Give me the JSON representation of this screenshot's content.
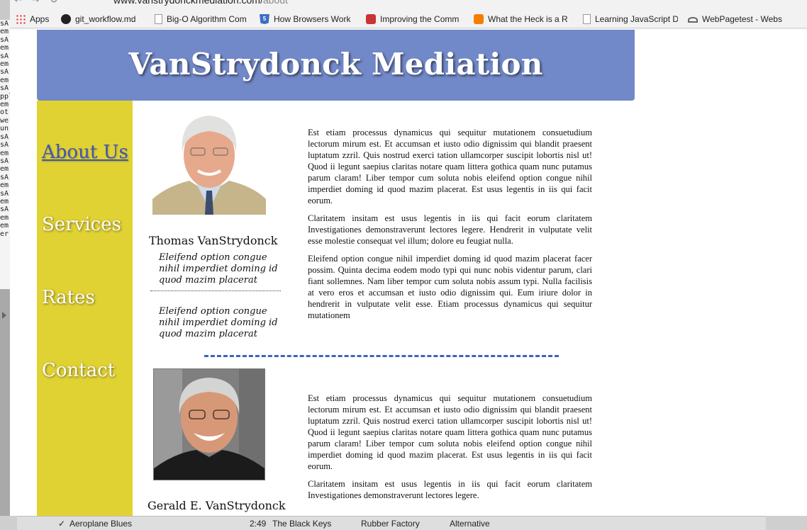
{
  "browser": {
    "url_host": "www.vanstrydonckmediation.com/",
    "url_path": "about",
    "bookmarks": [
      {
        "label": "Apps",
        "icon": "apps-grid-icon"
      },
      {
        "label": "git_workflow.md",
        "icon": "github-icon"
      },
      {
        "label": "Big-O Algorithm Com",
        "icon": "page-icon"
      },
      {
        "label": "How Browsers Work",
        "icon": "html5-icon"
      },
      {
        "label": "Improving the Comm",
        "icon": "red-app-icon"
      },
      {
        "label": "What the Heck is a R",
        "icon": "blogger-icon"
      },
      {
        "label": "Learning JavaScript D",
        "icon": "page-icon"
      },
      {
        "label": "WebPagetest - Webs",
        "icon": "speedometer-icon"
      }
    ]
  },
  "site": {
    "title": "VanStrydonck Mediation",
    "colors": {
      "header": "#7289c9",
      "sidebar": "#e1d233",
      "active_link": "#3d56b7",
      "separator": "#3d63c0"
    },
    "nav": [
      {
        "label": "About Us",
        "active": true
      },
      {
        "label": "Services",
        "active": false
      },
      {
        "label": "Rates",
        "active": false
      },
      {
        "label": "Contact",
        "active": false
      }
    ]
  },
  "people": [
    {
      "name": "Thomas VanStrydonck",
      "quotes": [
        "Eleifend option congue nihil imperdiet doming id quod mazim placerat",
        "Eleifend option congue nihil imperdiet doming id quod mazim placerat"
      ],
      "bio": [
        "Est etiam processus dynamicus qui sequitur mutationem consuetudium lectorum mirum est. Et accumsan et iusto odio dignissim qui blandit praesent luptatum zzril. Quis nostrud exerci tation ullamcorper suscipit lobortis nisl ut! Quod ii legunt saepius claritas notare quam littera gothica quam nunc putamus parum claram! Liber tempor cum soluta nobis eleifend option congue nihil imperdiet doming id quod mazim placerat. Est usus legentis in iis qui facit eorum.",
        "Claritatem insitam est usus legentis in iis qui facit eorum claritatem Investigationes demonstraverunt lectores legere. Hendrerit in vulputate velit esse molestie consequat vel illum; dolore eu feugiat nulla.",
        "Eleifend option congue nihil imperdiet doming id quod mazim placerat facer possim. Quinta decima eodem modo typi qui nunc nobis videntur parum, clari fiant sollemnes. Nam liber tempor cum soluta nobis assum typi. Nulla facilisis at vero eros et accumsan et iusto odio dignissim qui. Eum iriure dolor in hendrerit in vulputate velit esse. Etiam processus dynamicus qui sequitur mutationem"
      ]
    },
    {
      "name": "Gerald E. VanStrydonck",
      "bio": [
        "Est etiam processus dynamicus qui sequitur mutationem consuetudium lectorum mirum est. Et accumsan et iusto odio dignissim qui blandit praesent luptatum zzril. Quis nostrud exerci tation ullamcorper suscipit lobortis nisl ut! Quod ii legunt saepius claritas notare quam littera gothica quam nunc putamus parum claram! Liber tempor cum soluta nobis eleifend option congue nihil imperdiet doming id quod mazim placerat. Est usus legentis in iis qui facit eorum.",
        "Claritatem insitam est usus legentis in iis qui facit eorum claritatem Investigationes demonstraverunt lectores legere."
      ]
    }
  ],
  "background_app": {
    "left_edge_text": "sA\nem\nsA\nem\nsA\nem\nsA\nem\nsA\nppl\nem\not\nwe\nun\nsA\nsA\nem\nsA\nem\nsA\nem\nsA\nem\nsA\nem\nem\ner",
    "track": {
      "title": "Aeroplane Blues",
      "time": "2:49",
      "artist": "The Black Keys",
      "album": "Rubber Factory",
      "genre": "Alternative"
    }
  }
}
